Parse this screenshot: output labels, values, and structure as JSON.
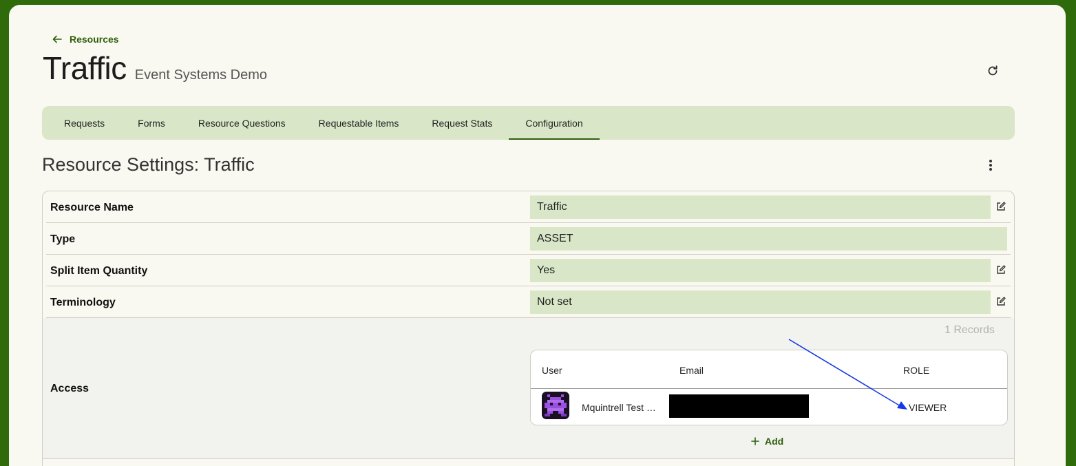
{
  "nav": {
    "back_label": "Resources"
  },
  "header": {
    "title": "Traffic",
    "subtitle": "Event Systems Demo"
  },
  "tabs": [
    {
      "label": "Requests"
    },
    {
      "label": "Forms"
    },
    {
      "label": "Resource Questions"
    },
    {
      "label": "Requestable Items"
    },
    {
      "label": "Request Stats"
    },
    {
      "label": "Configuration",
      "active": true
    }
  ],
  "section": {
    "title": "Resource Settings: Traffic"
  },
  "settings": {
    "resource_name": {
      "label": "Resource Name",
      "value": "Traffic"
    },
    "type": {
      "label": "Type",
      "value": "ASSET"
    },
    "split_item_quantity": {
      "label": "Split Item Quantity",
      "value": "Yes"
    },
    "terminology": {
      "label": "Terminology",
      "value": "Not set"
    },
    "access": {
      "label": "Access",
      "records": "1 Records",
      "columns": {
        "user": "User",
        "email": "Email",
        "role": "ROLE"
      },
      "rows": [
        {
          "user": "Mquintrell Test …",
          "role": "VIEWER"
        }
      ],
      "add_label": "Add"
    }
  },
  "colors": {
    "brand_green": "#2e5e0b",
    "tab_bar_bg": "#d9e7c8",
    "annotation_arrow": "#1538e8"
  },
  "icons": [
    "arrow-left-icon",
    "refresh-icon",
    "more-vert-icon",
    "edit-icon",
    "plus-icon"
  ]
}
